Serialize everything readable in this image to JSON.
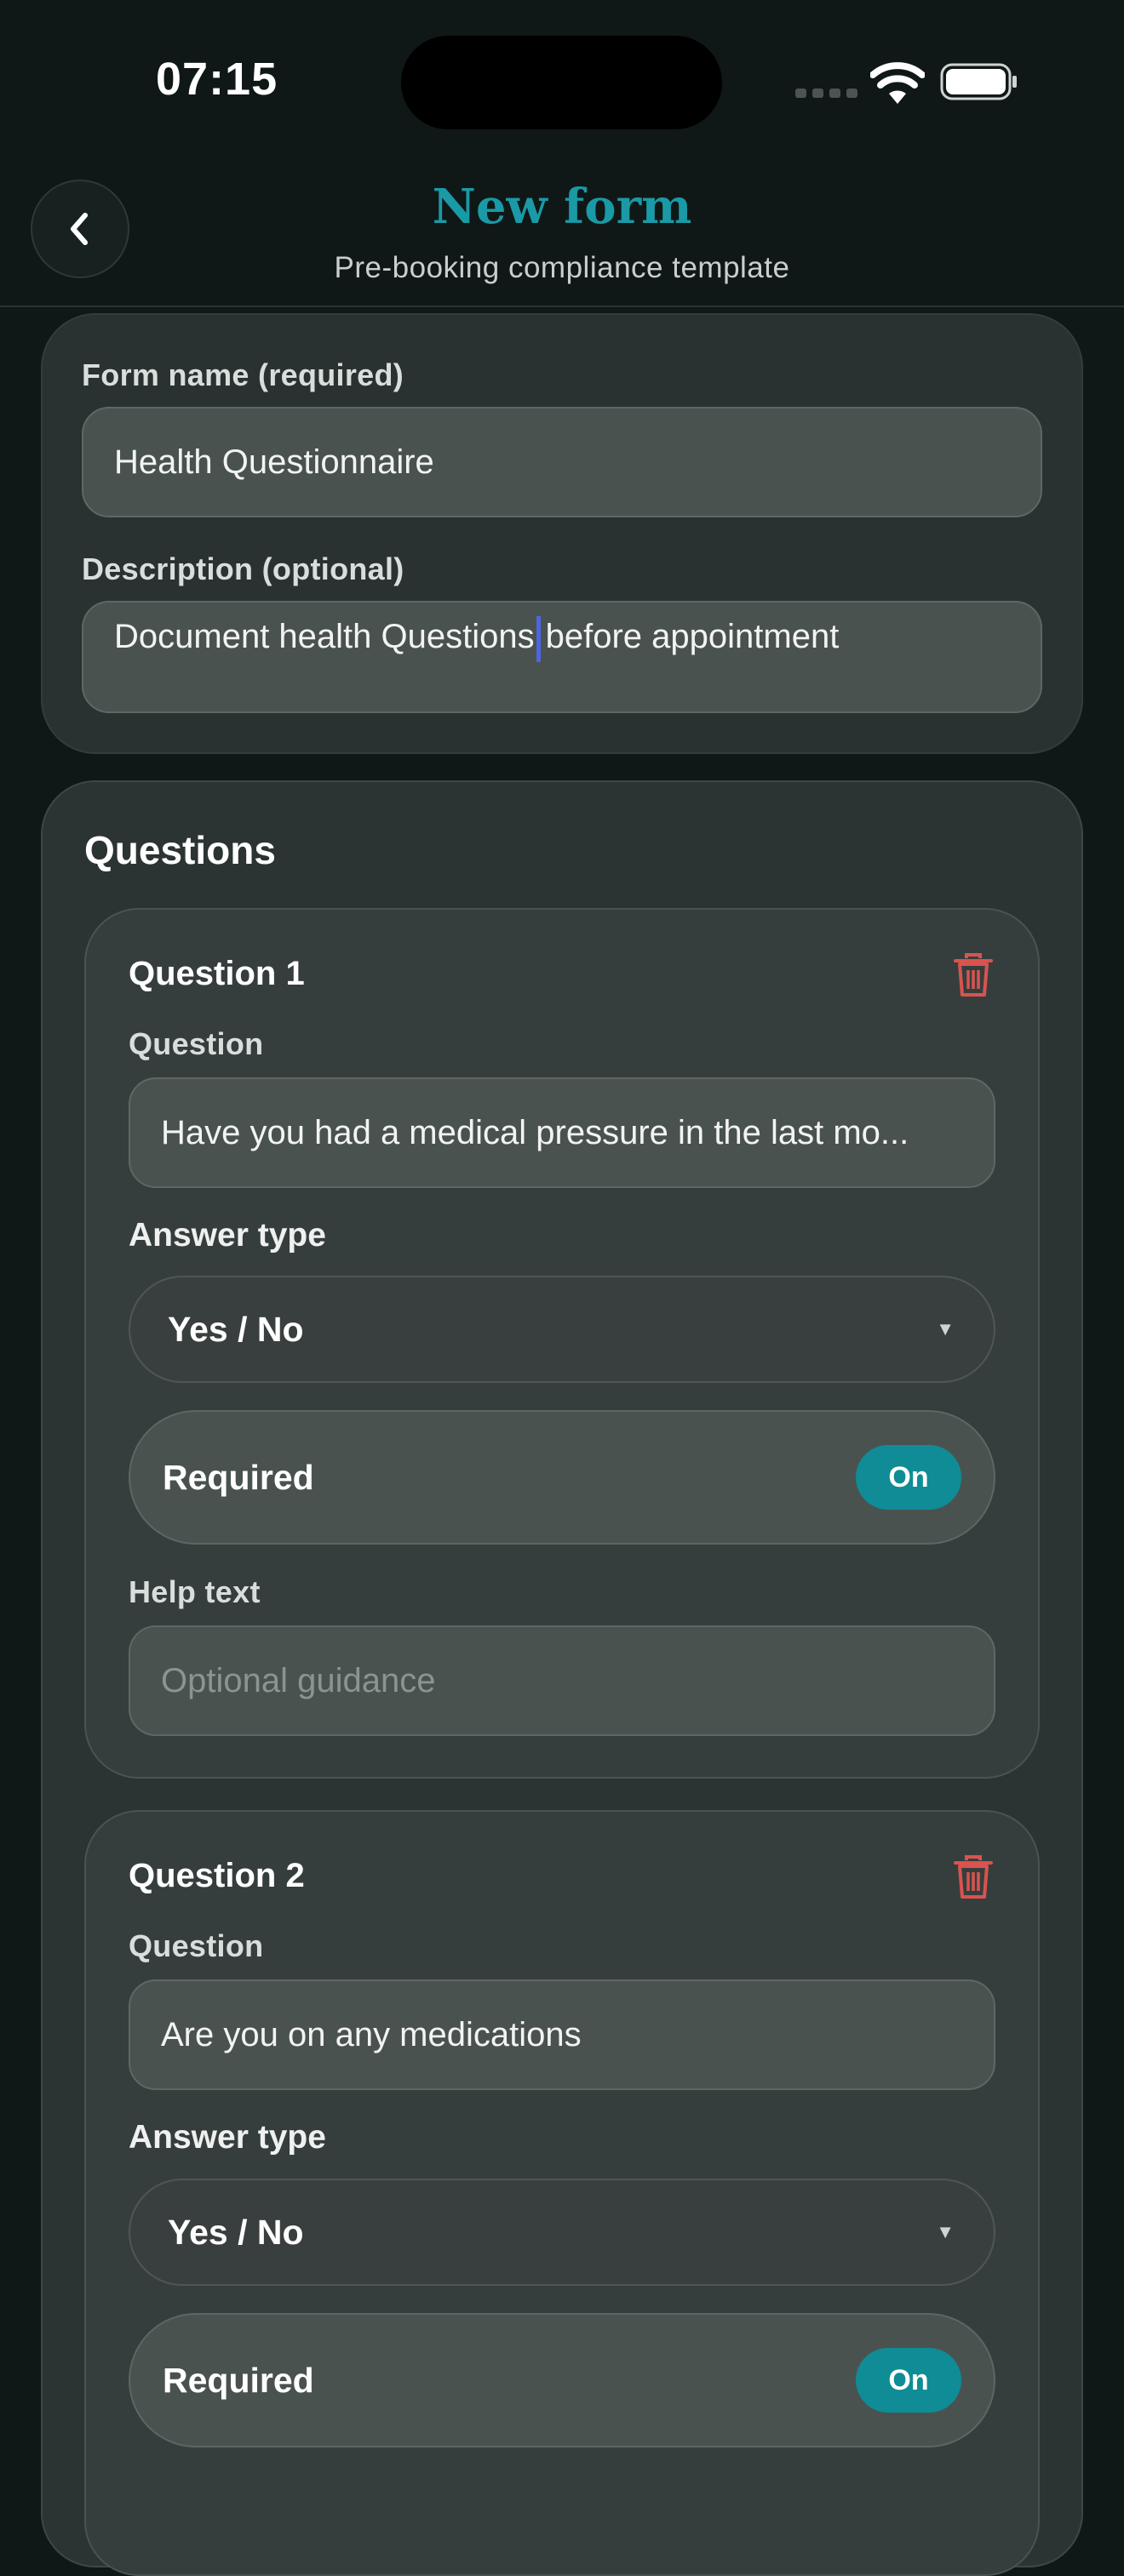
{
  "status_bar": {
    "time": "07:15"
  },
  "header": {
    "title": "New form",
    "subtitle": "Pre-booking compliance template"
  },
  "form": {
    "name_label": "Form name (required)",
    "name_value": "Health Questionnaire",
    "description_label": "Description (optional)",
    "description_before_caret": "Document health Questions",
    "description_after_caret": "before appointment"
  },
  "questions_section": {
    "title": "Questions",
    "items": [
      {
        "title": "Question 1",
        "question_label": "Question",
        "question_value": "Have you had a medical pressure in the last mo...",
        "answer_type_label": "Answer type",
        "answer_type_value": "Yes / No",
        "required_label": "Required",
        "required_state": "On",
        "help_text_label": "Help text",
        "help_text_placeholder": "Optional guidance"
      },
      {
        "title": "Question 2",
        "question_label": "Question",
        "question_value": "Are you on any medications",
        "answer_type_label": "Answer type",
        "answer_type_value": "Yes / No",
        "required_label": "Required",
        "required_state": "On"
      }
    ]
  },
  "colors": {
    "accent": "#0f8c96",
    "title": "#1a9aa6",
    "delete": "#d9534f",
    "caret": "#4d66e0"
  },
  "icons": [
    "chevron-left-icon",
    "trash-icon",
    "chevron-down-icon",
    "wifi-icon",
    "battery-icon",
    "signal-icon"
  ]
}
